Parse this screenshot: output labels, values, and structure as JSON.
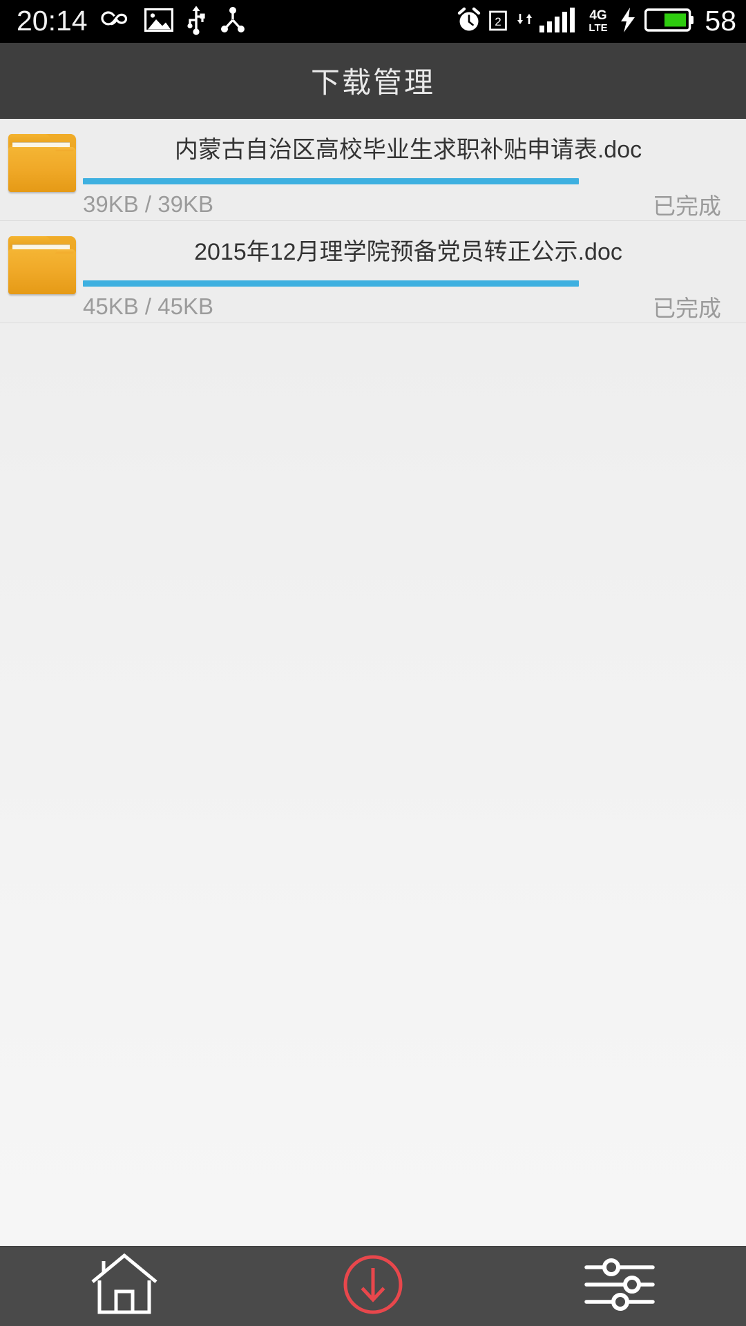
{
  "statusbar": {
    "time": "20:14",
    "battery_percent": "58",
    "left_icons": [
      "infinity-icon",
      "image-icon",
      "usb-icon",
      "debug-share-icon"
    ],
    "right_icons": [
      "alarm-icon",
      "sim2-icon",
      "data-transfer-icon",
      "signal-bars-icon",
      "4g-lte-icon",
      "charging-bolt-icon",
      "battery-icon"
    ],
    "network_label_top": "4G",
    "network_label_bottom": "LTE",
    "sim_label": "2",
    "battery_color": "#2ecc0f",
    "bar_background": "#000000"
  },
  "header": {
    "title": "下载管理",
    "background": "#3e3e3e",
    "text_color": "#e9e9e9"
  },
  "downloads": {
    "progress_color": "#3eb0e0",
    "items": [
      {
        "filename": "内蒙古自治区高校毕业生求职补贴申请表.doc",
        "downloaded": "39KB",
        "total": "39KB",
        "size_text": "39KB / 39KB",
        "status": "已完成",
        "progress_percent": 100,
        "icon": "folder-icon"
      },
      {
        "filename": "2015年12月理学院预备党员转正公示.doc",
        "downloaded": "45KB",
        "total": "45KB",
        "size_text": "45KB / 45KB",
        "status": "已完成",
        "progress_percent": 100,
        "icon": "folder-icon"
      }
    ]
  },
  "bottomnav": {
    "background": "#4a4a4a",
    "active_color": "#e8474c",
    "inactive_color": "#ffffff",
    "items": [
      {
        "name": "home",
        "icon": "home-icon",
        "active": false
      },
      {
        "name": "downloads",
        "icon": "download-circle-icon",
        "active": true
      },
      {
        "name": "settings",
        "icon": "sliders-icon",
        "active": false
      }
    ]
  }
}
